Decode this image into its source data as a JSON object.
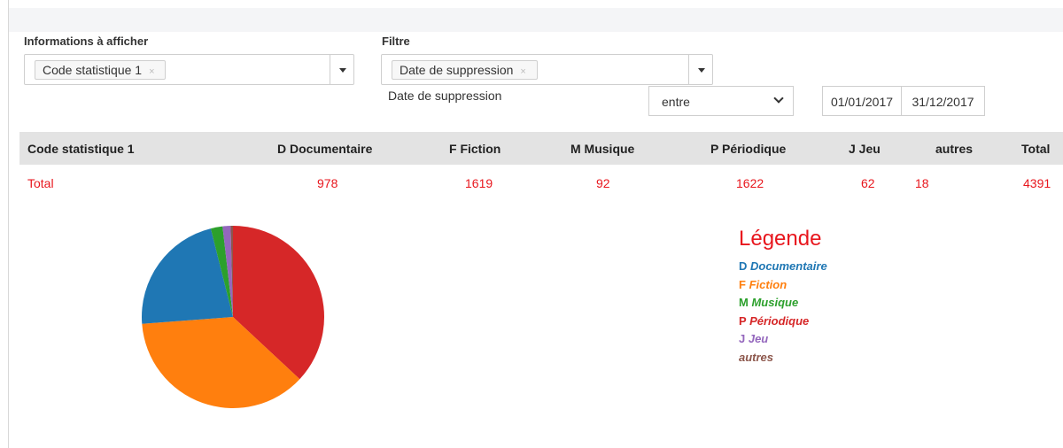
{
  "form": {
    "display_label": "Informations à afficher",
    "display_tag": "Code statistique 1",
    "display_tag_remove": "×",
    "filter_label": "Filtre",
    "filter_tag": "Date de suppression",
    "filter_tag_remove": "×",
    "date_field_label": "Date de suppression",
    "operator_value": "entre",
    "date_from": "01/01/2017",
    "date_to": "31/12/2017"
  },
  "table": {
    "headers": [
      "Code statistique 1",
      "D Documentaire",
      "F Fiction",
      "M Musique",
      "P Périodique",
      "J Jeu",
      "autres",
      "Total"
    ],
    "total_row": [
      "Total",
      "978",
      "1619",
      "92",
      "1622",
      "62",
      "18",
      "4391"
    ]
  },
  "legend": {
    "title": "Légende",
    "items": [
      {
        "code": "D",
        "name": "Documentaire",
        "color": "#1f77b4"
      },
      {
        "code": "F",
        "name": "Fiction",
        "color": "#ff7f0e"
      },
      {
        "code": "M",
        "name": "Musique",
        "color": "#2ca02c"
      },
      {
        "code": "P",
        "name": "Périodique",
        "color": "#d62728"
      },
      {
        "code": "J",
        "name": "Jeu",
        "color": "#9467bd"
      },
      {
        "code": "",
        "name": "autres",
        "color": "#8c564b"
      }
    ]
  },
  "chart_data": {
    "type": "pie",
    "categories": [
      "D Documentaire",
      "F Fiction",
      "M Musique",
      "P Périodique",
      "J Jeu",
      "autres"
    ],
    "values": [
      978,
      1619,
      92,
      1622,
      62,
      18
    ],
    "colors": [
      "#1f77b4",
      "#ff7f0e",
      "#2ca02c",
      "#d62728",
      "#9467bd",
      "#8c564b"
    ]
  },
  "colors": {
    "accent_red": "#e8161d",
    "header_bg": "#e3e3e3",
    "topbar_bg": "#f4f5f7"
  }
}
